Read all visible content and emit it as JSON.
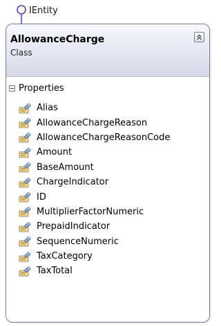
{
  "interface": {
    "name": "IEntity"
  },
  "class": {
    "name": "AllowanceCharge",
    "kind": "Class",
    "collapse_icon": "double-chevron-up-icon"
  },
  "properties_section": {
    "title": "Properties",
    "toggle_icon": "collapse-minus-icon",
    "item_icon": "property-icon",
    "items": [
      "Alias",
      "AllowanceChargeReason",
      "AllowanceChargeReasonCode",
      "Amount",
      "BaseAmount",
      "ChargeIndicator",
      "ID",
      "MultiplierFactorNumeric",
      "PrepaidIndicator",
      "SequenceNumeric",
      "TaxCategory",
      "TaxTotal"
    ]
  },
  "colors": {
    "lollipop": "#6a3dab",
    "header_gradient_top": "#f7f8fc",
    "header_gradient_bottom": "#d6d9e6",
    "border": "#7a7a9a"
  }
}
